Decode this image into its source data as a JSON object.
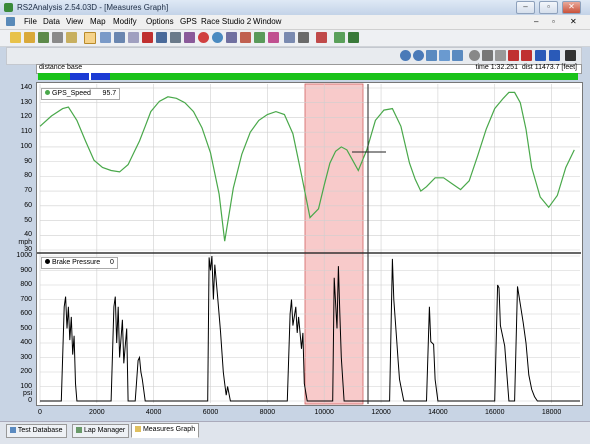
{
  "window": {
    "title": "RS2Analysis 2.54.03D - [Measures Graph]",
    "controls": [
      "–",
      "▫",
      "✕"
    ],
    "doc_controls": [
      "–",
      "▫",
      "✕"
    ]
  },
  "menu": [
    "File",
    "Data",
    "View",
    "Map",
    "Modify",
    "Options",
    "GPS",
    "Race Studio 2",
    "Window"
  ],
  "distance_bar": {
    "label": "distance base",
    "time": "time 1:32.251",
    "dist": "dist 11473.7 [feet]"
  },
  "top_chart": {
    "legend": {
      "name": "GPS_Speed",
      "value": "95.7"
    },
    "unit": "mph",
    "y_ticks": [
      140,
      130,
      120,
      110,
      100,
      90,
      80,
      70,
      60,
      50,
      40,
      30
    ]
  },
  "bottom_chart": {
    "legend": {
      "name": "Brake Pressure",
      "value": "0"
    },
    "unit": "psi",
    "y_ticks": [
      1000,
      900,
      800,
      700,
      600,
      500,
      400,
      300,
      200,
      100,
      0
    ]
  },
  "x_ticks": [
    0,
    2000,
    4000,
    6000,
    8000,
    10000,
    12000,
    14000,
    16000,
    18000
  ],
  "tabs": [
    "Test Database",
    "Lap Manager",
    "Measures Graph"
  ],
  "active_tab": "Measures Graph",
  "colors": {
    "speed_line": "#49a84a",
    "brake_line": "#000000",
    "highlight": "#f5b8b8",
    "green_bar": "#19c219",
    "blue_cursor": "#1b3bd4"
  },
  "chart_data": [
    {
      "type": "line",
      "title": "",
      "xlabel": "",
      "ylabel": "mph",
      "xlim": [
        0,
        19000
      ],
      "ylim": [
        30,
        140
      ],
      "series": [
        {
          "name": "GPS_Speed",
          "x": [
            0,
            400,
            800,
            1000,
            1300,
            1600,
            1900,
            2200,
            2500,
            2800,
            3100,
            3300,
            3500,
            3700,
            3900,
            4200,
            4500,
            4800,
            5100,
            5400,
            5700,
            6000,
            6300,
            6500,
            6800,
            7100,
            7400,
            7700,
            8000,
            8300,
            8600,
            8900,
            9200,
            9500,
            9800,
            10000,
            10200,
            10400,
            10600,
            10800,
            11000,
            11200,
            11500,
            11800,
            12100,
            12400,
            12700,
            13000,
            13200,
            13400,
            13600,
            13900,
            14200,
            14500,
            14800,
            15100,
            15400,
            15700,
            16000,
            16300,
            16500,
            16700,
            16900,
            17100,
            17300,
            17600,
            17900,
            18200,
            18500,
            18800
          ],
          "y": [
            114,
            121,
            126,
            127,
            118,
            104,
            91,
            86,
            84,
            83,
            88,
            96,
            104,
            114,
            124,
            131,
            134,
            133,
            130,
            124,
            113,
            96,
            68,
            36,
            72,
            95,
            110,
            118,
            122,
            124,
            122,
            109,
            81,
            52,
            58,
            74,
            89,
            97,
            100,
            98,
            91,
            84,
            98,
            118,
            125,
            126,
            114,
            89,
            78,
            70,
            73,
            79,
            79,
            75,
            71,
            77,
            94,
            112,
            126,
            133,
            137,
            137,
            130,
            112,
            86,
            66,
            59,
            67,
            86,
            98
          ]
        }
      ]
    },
    {
      "type": "line",
      "title": "",
      "xlabel": "",
      "ylabel": "psi",
      "xlim": [
        0,
        19000
      ],
      "ylim": [
        0,
        1000
      ],
      "series": [
        {
          "name": "Brake Pressure",
          "x": [
            0,
            750,
            850,
            900,
            950,
            1000,
            1050,
            1100,
            1150,
            1200,
            1250,
            1300,
            1500,
            2500,
            2600,
            2650,
            2700,
            2750,
            2800,
            2900,
            2950,
            3050,
            3100,
            3350,
            3450,
            3500,
            3550,
            3600,
            3700,
            5900,
            5950,
            6000,
            6050,
            6100,
            6150,
            6250,
            6350,
            6450,
            6500,
            6550,
            6600,
            6700,
            8700,
            8800,
            8850,
            8900,
            9000,
            9050,
            9100,
            9200,
            9250,
            9300,
            9400,
            9500,
            10300,
            10350,
            10450,
            10500,
            10550,
            10600,
            10700,
            11400,
            12300,
            12400,
            12450,
            12550,
            12600,
            12650,
            12700,
            12800,
            13600,
            13700,
            13750,
            13850,
            13900,
            14000,
            16000,
            16100,
            16150,
            16200,
            16350,
            16500,
            16700,
            16800,
            17000,
            17100,
            17200,
            17300,
            17400,
            17500,
            19000
          ],
          "y": [
            0,
            0,
            650,
            720,
            500,
            650,
            420,
            580,
            320,
            450,
            120,
            0,
            0,
            0,
            650,
            720,
            400,
            650,
            300,
            560,
            260,
            500,
            0,
            0,
            280,
            300,
            200,
            150,
            0,
            0,
            990,
            900,
            1000,
            700,
            940,
            720,
            480,
            200,
            120,
            40,
            100,
            0,
            0,
            600,
            700,
            520,
            650,
            470,
            580,
            360,
            470,
            120,
            0,
            0,
            0,
            850,
            500,
            930,
            610,
            300,
            0,
            0,
            0,
            980,
            700,
            420,
            280,
            150,
            100,
            0,
            0,
            650,
            410,
            390,
            150,
            0,
            0,
            800,
            780,
            520,
            380,
            0,
            0,
            790,
            540,
            400,
            180,
            80,
            30,
            0,
            0
          ]
        }
      ]
    }
  ]
}
